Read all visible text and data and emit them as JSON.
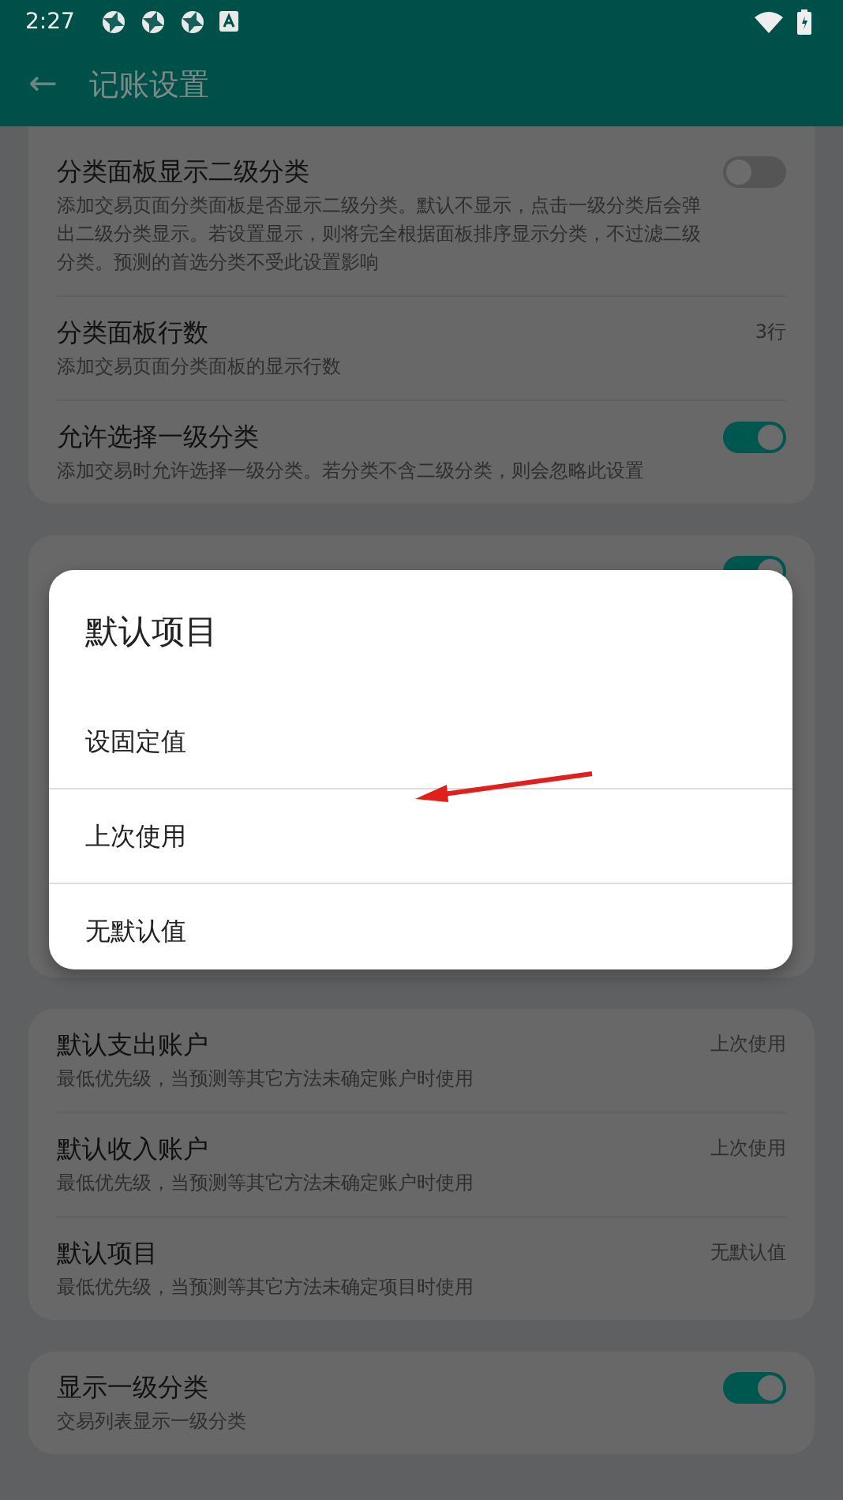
{
  "status_bar": {
    "time": "2:27"
  },
  "app_bar": {
    "title": "记账设置",
    "back": "←"
  },
  "cards": [
    {
      "items": [
        {
          "kind": "toggle",
          "title": "分类面板显示二级分类",
          "desc": "添加交易页面分类面板是否显示二级分类。默认不显示，点击一级分类后会弹出二级分类显示。若设置显示，则将完全根据面板排序显示分类，不过滤二级分类。预测的首选分类不受此设置影响",
          "checked": false
        },
        {
          "kind": "value",
          "title": "分类面板行数",
          "desc": "添加交易页面分类面板的显示行数",
          "value": "3行"
        },
        {
          "kind": "toggle",
          "title": "允许选择一级分类",
          "desc": "添加交易时允许选择一级分类。若分类不含二级分类，则会忽略此设置",
          "checked": true
        }
      ]
    },
    {
      "items": [
        {
          "kind": "toggle",
          "checked": true
        }
      ]
    },
    {
      "items": [
        {
          "kind": "value",
          "title": "默认支出账户",
          "desc": "最低优先级，当预测等其它方法未确定账户时使用",
          "value": "上次使用"
        },
        {
          "kind": "value",
          "title": "默认收入账户",
          "desc": "最低优先级，当预测等其它方法未确定账户时使用",
          "value": "上次使用"
        },
        {
          "kind": "value",
          "title": "默认项目",
          "desc": "最低优先级，当预测等其它方法未确定项目时使用",
          "value": "无默认值"
        }
      ]
    },
    {
      "items": [
        {
          "kind": "toggle",
          "title": "显示一级分类",
          "desc": "交易列表显示一级分类",
          "checked": true
        }
      ]
    }
  ],
  "dialog": {
    "title": "默认项目",
    "options": [
      "设固定值",
      "上次使用",
      "无默认值"
    ]
  }
}
